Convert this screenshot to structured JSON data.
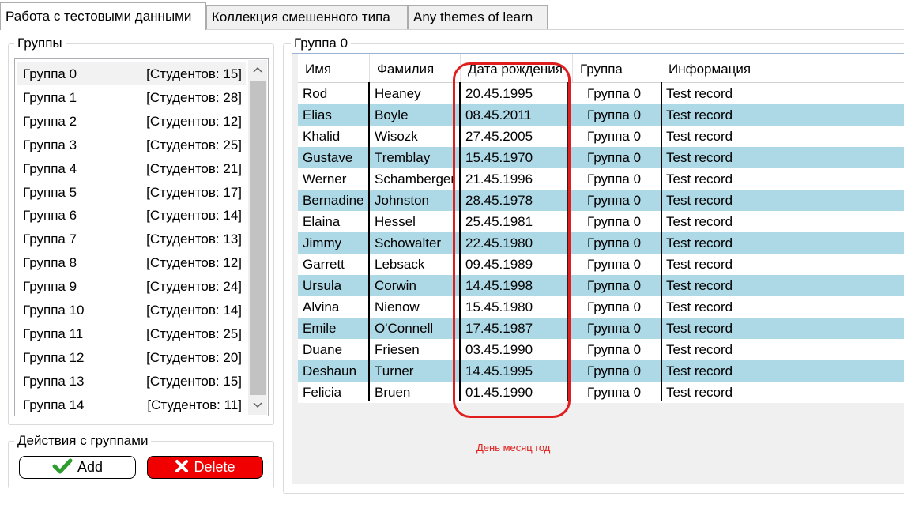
{
  "tabs": [
    {
      "label": "Работа с тестовыми данными",
      "active": true
    },
    {
      "label": "Коллекция смешенного типа",
      "active": false
    },
    {
      "label": "Any themes of learn",
      "active": false
    }
  ],
  "groups_panel": {
    "title": "Группы",
    "items": [
      {
        "name": "Группа 0",
        "count": "[Студентов: 15]"
      },
      {
        "name": "Группа 1",
        "count": "[Студентов: 28]"
      },
      {
        "name": "Группа 2",
        "count": "[Студентов: 12]"
      },
      {
        "name": "Группа 3",
        "count": "[Студентов: 25]"
      },
      {
        "name": "Группа 4",
        "count": "[Студентов: 21]"
      },
      {
        "name": "Группа 5",
        "count": "[Студентов: 17]"
      },
      {
        "name": "Группа 6",
        "count": "[Студентов: 14]"
      },
      {
        "name": "Группа 7",
        "count": "[Студентов: 13]"
      },
      {
        "name": "Группа 8",
        "count": "[Студентов: 12]"
      },
      {
        "name": "Группа 9",
        "count": "[Студентов: 24]"
      },
      {
        "name": "Группа 10",
        "count": "[Студентов: 14]"
      },
      {
        "name": "Группа 11",
        "count": "[Студентов: 25]"
      },
      {
        "name": "Группа 12",
        "count": "[Студентов: 20]"
      },
      {
        "name": "Группа 13",
        "count": "[Студентов: 15]"
      },
      {
        "name": "Группа 14",
        "count": "[Студентов: 11]"
      }
    ]
  },
  "actions_panel": {
    "title": "Действия с группами",
    "add_label": "Add",
    "delete_label": "Delete"
  },
  "grid_panel": {
    "title": "Группа 0",
    "columns": [
      "Имя",
      "Фамилия",
      "Дата рождения",
      "Группа",
      "Информация"
    ],
    "rows": [
      [
        "Rod",
        "Heaney",
        "20.45.1995",
        "Группа 0",
        "Test record"
      ],
      [
        "Elias",
        "Boyle",
        "08.45.2011",
        "Группа 0",
        "Test record"
      ],
      [
        "Khalid",
        "Wisozk",
        "27.45.2005",
        "Группа 0",
        "Test record"
      ],
      [
        "Gustave",
        "Tremblay",
        "15.45.1970",
        "Группа 0",
        "Test record"
      ],
      [
        "Werner",
        "Schamberger",
        "21.45.1996",
        "Группа 0",
        "Test record"
      ],
      [
        "Bernadine",
        "Johnston",
        "28.45.1978",
        "Группа 0",
        "Test record"
      ],
      [
        "Elaina",
        "Hessel",
        "25.45.1981",
        "Группа 0",
        "Test record"
      ],
      [
        "Jimmy",
        "Schowalter",
        "22.45.1980",
        "Группа 0",
        "Test record"
      ],
      [
        "Garrett",
        "Lebsack",
        "09.45.1989",
        "Группа 0",
        "Test record"
      ],
      [
        "Ursula",
        "Corwin",
        "14.45.1998",
        "Группа 0",
        "Test record"
      ],
      [
        "Alvina",
        "Nienow",
        "15.45.1980",
        "Группа 0",
        "Test record"
      ],
      [
        "Emile",
        "O'Connell",
        "17.45.1987",
        "Группа 0",
        "Test record"
      ],
      [
        "Duane",
        "Friesen",
        "03.45.1990",
        "Группа 0",
        "Test record"
      ],
      [
        "Deshaun",
        "Turner",
        "14.45.1995",
        "Группа 0",
        "Test record"
      ],
      [
        "Felicia",
        "Bruen",
        "01.45.1990",
        "Группа 0",
        "Test record"
      ]
    ],
    "annotation": "День месяц год"
  },
  "colors": {
    "alt_row": "#add8e6",
    "delete_button": "#f00000",
    "annotation": "#e01e1e",
    "check_icon": "#2e9c2e"
  },
  "icons": {
    "add": "check-icon",
    "delete": "close-icon"
  }
}
